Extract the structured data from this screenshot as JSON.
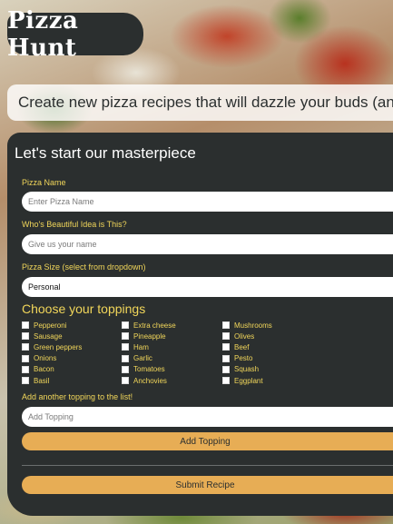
{
  "brand": {
    "name": "Pizza Hunt"
  },
  "tagline": "Create new pizza recipes that will dazzle your buds (and t",
  "form": {
    "title": "Let's start our masterpiece",
    "pizza_name": {
      "label": "Pizza Name",
      "placeholder": "Enter Pizza Name",
      "value": ""
    },
    "created_by": {
      "label": "Who's Beautiful Idea is This?",
      "placeholder": "Give us your name",
      "value": ""
    },
    "size": {
      "label": "Pizza Size (select from dropdown)",
      "selected": "Personal"
    },
    "toppings_heading": "Choose your toppings",
    "toppings_columns": [
      [
        "Pepperoni",
        "Sausage",
        "Green peppers",
        "Onions",
        "Bacon",
        "Basil"
      ],
      [
        "Extra cheese",
        "Pineapple",
        "Ham",
        "Garlic",
        "Tomatoes",
        "Anchovies"
      ],
      [
        "Mushrooms",
        "Olives",
        "Beef",
        "Pesto",
        "Squash",
        "Eggplant"
      ]
    ],
    "new_topping": {
      "label": "Add another topping to the list!",
      "placeholder": "Add Topping",
      "value": ""
    },
    "add_topping_button": "Add Topping",
    "submit_button": "Submit Recipe"
  },
  "colors": {
    "panel": "#2b2f2f",
    "label_yellow": "#f1d65a",
    "button_orange": "#e7ad55",
    "white": "#ffffff"
  }
}
